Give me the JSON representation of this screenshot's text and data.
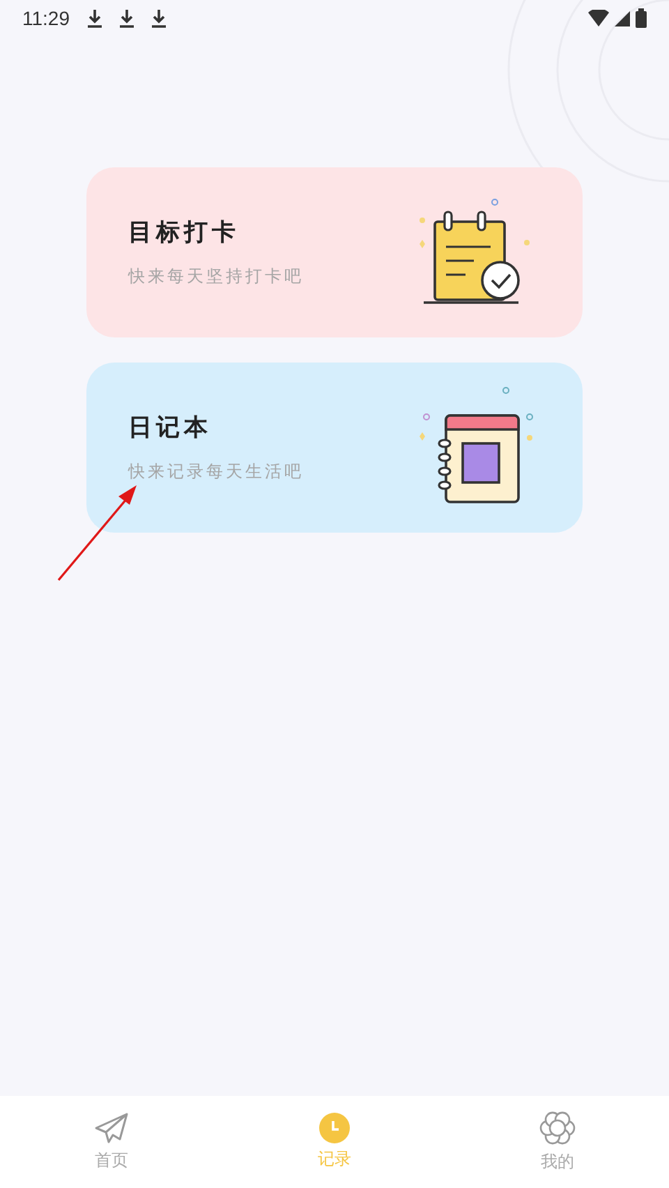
{
  "status_bar": {
    "time": "11:29",
    "notifications": [
      {
        "kind": "download"
      },
      {
        "kind": "download"
      },
      {
        "kind": "download"
      }
    ]
  },
  "cards": [
    {
      "kind": "checkin",
      "title": "目标打卡",
      "subtitle": "快来每天坚持打卡吧",
      "color": "#fde4e6"
    },
    {
      "kind": "diary",
      "title": "日记本",
      "subtitle": "快来记录每天生活吧",
      "color": "#d6eefc"
    }
  ],
  "tabs": [
    {
      "kind": "plane",
      "label": "首页",
      "selected": false
    },
    {
      "kind": "clock",
      "label": "记录",
      "selected": true
    },
    {
      "kind": "flower",
      "label": "我的",
      "selected": false
    }
  ]
}
